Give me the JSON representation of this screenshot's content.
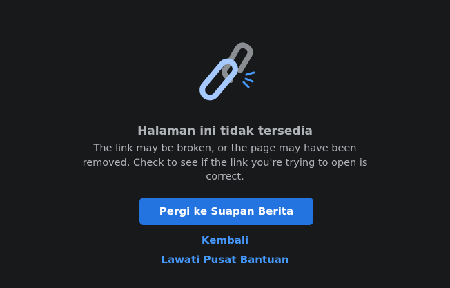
{
  "colors": {
    "background": "#18191a",
    "text_secondary": "#b0b3b8",
    "primary_button": "#2374e1",
    "link": "#4599ff",
    "chain_light": "#a6c9ff",
    "chain_dark": "#8a8d91",
    "spark": "#4599ff"
  },
  "illustration": {
    "icon": "broken-link-icon"
  },
  "error": {
    "title": "Halaman ini tidak tersedia",
    "description": "The link may be broken, or the page may have been removed. Check to see if the link you're trying to open is correct."
  },
  "actions": {
    "primary_label": "Pergi ke Suapan Berita",
    "back_label": "Kembali",
    "help_label": "Lawati Pusat Bantuan"
  }
}
